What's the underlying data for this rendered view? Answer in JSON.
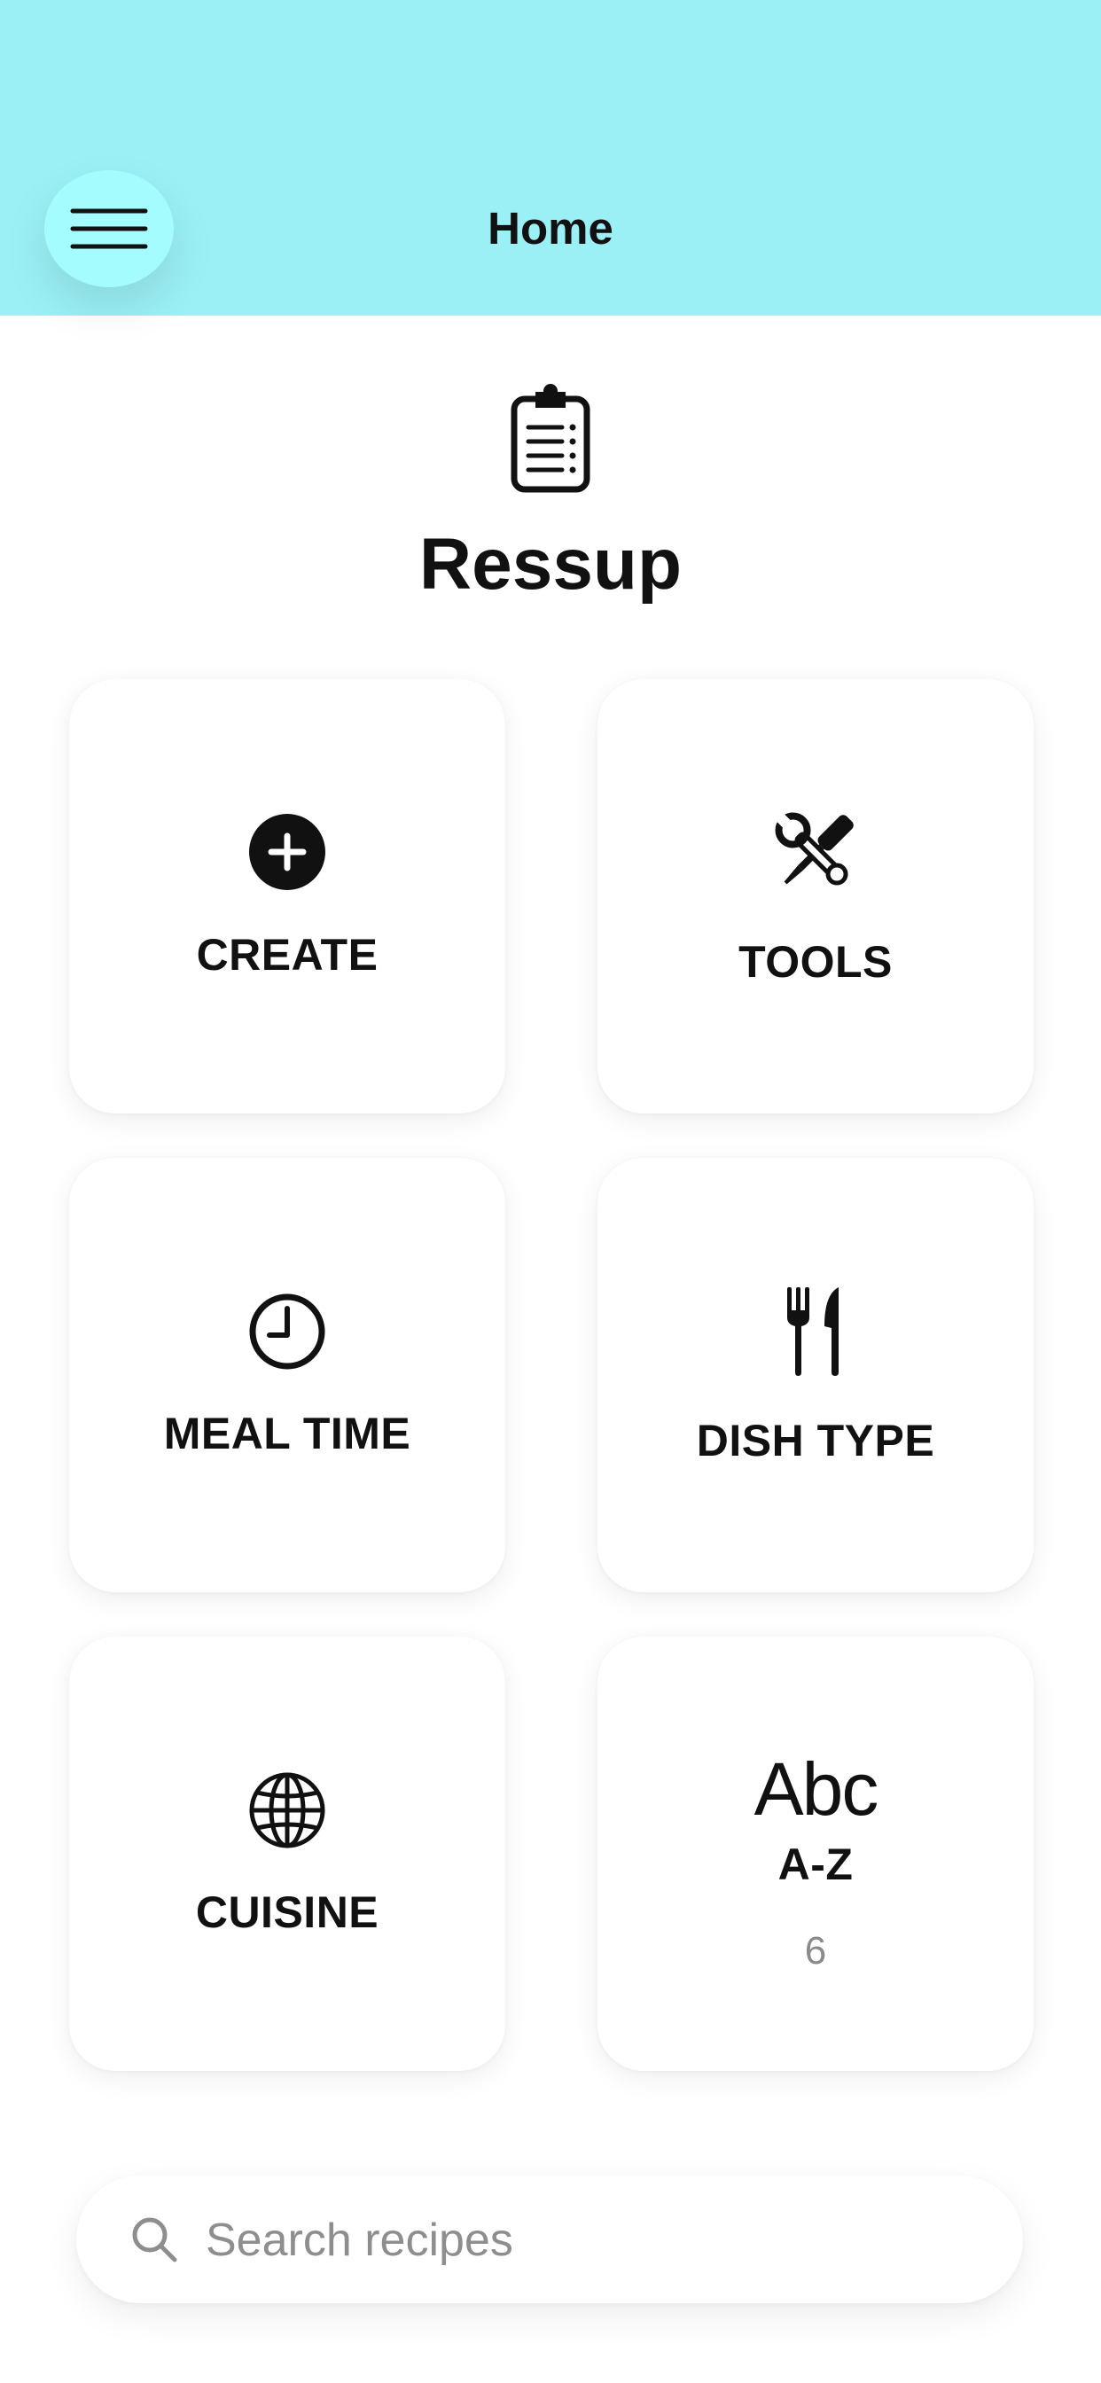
{
  "header": {
    "title": "Home",
    "menu_icon": "hamburger-icon",
    "background": "#9af0f5",
    "menu_button_color": "#a4fcfe"
  },
  "app": {
    "title": "Ressup",
    "logo_icon": "clipboard-list-icon"
  },
  "tiles": [
    {
      "label": "CREATE",
      "icon": "plus-circle-icon"
    },
    {
      "label": "TOOLS",
      "icon": "tools-icon"
    },
    {
      "label": "MEAL TIME",
      "icon": "clock-icon"
    },
    {
      "label": "DISH TYPE",
      "icon": "fork-knife-icon"
    },
    {
      "label": "CUISINE",
      "icon": "globe-icon"
    },
    {
      "label": "A-Z",
      "icon_text": "Abc",
      "count": "6"
    }
  ],
  "search": {
    "placeholder": "Search recipes",
    "value": "",
    "icon": "search-icon"
  }
}
